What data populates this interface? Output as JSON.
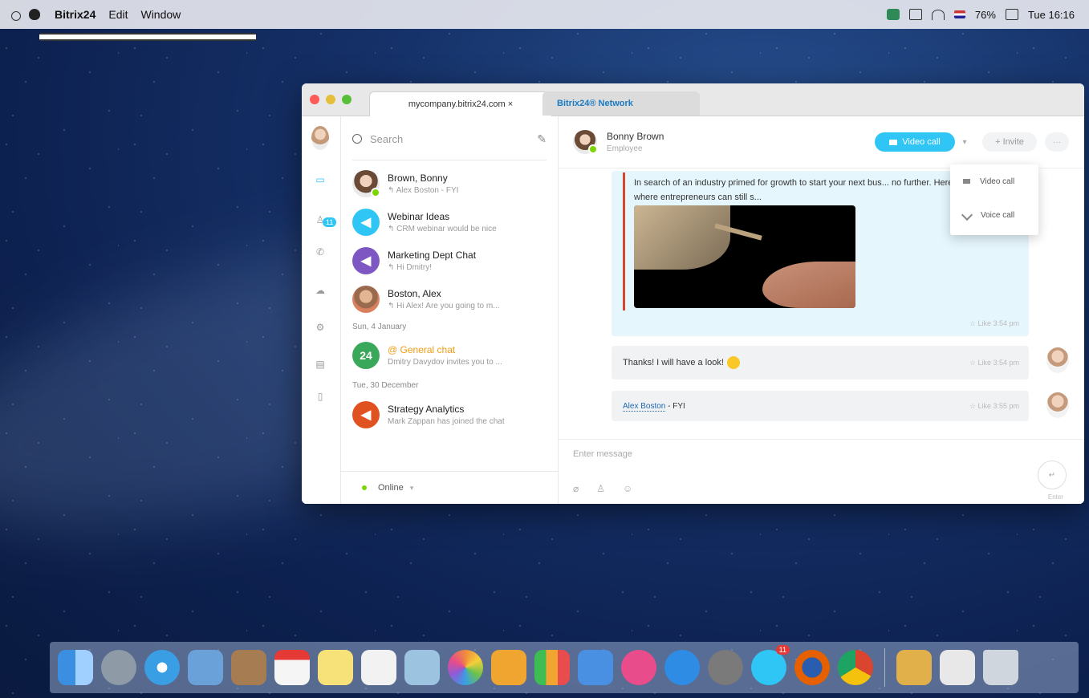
{
  "menubar": {
    "app_name": "Bitrix24",
    "menus": [
      "Edit",
      "Window"
    ],
    "battery": "76%",
    "clock": "Tue 16:16"
  },
  "window": {
    "tabs": [
      {
        "label": "mycompany.bitrix24.com ×"
      },
      {
        "label": "Bitrix24® Network"
      }
    ]
  },
  "sidebar": {
    "badge": "11",
    "icons": [
      "chat-icon",
      "contacts-icon",
      "phone-icon",
      "cloud-icon",
      "settings-icon",
      "calendar-icon",
      "document-icon"
    ]
  },
  "chat_list": {
    "search_placeholder": "Search",
    "items": [
      {
        "name": "Brown, Bonny",
        "preview": "↰ Alex Boston - FYI",
        "avatar_color": "#c49a7a"
      },
      {
        "name": "Webinar Ideas",
        "preview": "↰ CRM webinar would be nice",
        "avatar_color": "#2fc6f6"
      },
      {
        "name": "Marketing Dept Chat",
        "preview": "↰ Hi Dmitry!",
        "avatar_color": "#7e57c2"
      },
      {
        "name": "Boston, Alex",
        "preview": "↰ Hi Alex! Are you going to m...",
        "avatar_color": "#d9805f"
      },
      {
        "name": "@ General chat",
        "preview": "Dmitry Davydov invites you to ...",
        "avatar_color": "#3aa85a",
        "avatar_text": "24"
      },
      {
        "name": "Strategy Analytics",
        "preview": "Mark Zappan has joined the chat",
        "avatar_color": "#e0521f"
      }
    ],
    "date_separators": [
      "Sun, 4 January",
      "Tue, 30 December"
    ],
    "status": "Online"
  },
  "chat": {
    "contact_name": "Bonny Brown",
    "contact_role": "Employee",
    "video_call_label": "Video call",
    "invite_label": "+ Invite",
    "more_label": "···",
    "dropdown": {
      "video": "Video call",
      "voice": "Voice call"
    },
    "message1": {
      "text": "In search of an industry primed for growth to start your next bus... no further. Here are eight sectors where entrepreneurs can still s...",
      "meta": "☆ Like  3:54 pm"
    },
    "message2": {
      "text": "Thanks! I will have a look!",
      "meta": "☆ Like  3:54 pm"
    },
    "message3": {
      "mention": "Alex Boston",
      "text": " - FYI",
      "meta": "☆ Like  3:55 pm"
    },
    "composer_placeholder": "Enter message",
    "send_label": "Enter"
  },
  "dock": {
    "badge": "11",
    "apps": [
      {
        "name": "finder",
        "color": "#3b8fe0"
      },
      {
        "name": "launchpad",
        "color": "#8e9aa6"
      },
      {
        "name": "safari",
        "color": "#3a9ee4"
      },
      {
        "name": "preview",
        "color": "#6aa1d8"
      },
      {
        "name": "contacts",
        "color": "#a67c52"
      },
      {
        "name": "calendar",
        "color": "#f5f5f5"
      },
      {
        "name": "notes",
        "color": "#f7e27a"
      },
      {
        "name": "reminders",
        "color": "#f2f2f2"
      },
      {
        "name": "photo-browser",
        "color": "#9cc3e0"
      },
      {
        "name": "photos",
        "color": "#f08a3c"
      },
      {
        "name": "pages",
        "color": "#f0a530"
      },
      {
        "name": "numbers",
        "color": "#3dbd52"
      },
      {
        "name": "keynote",
        "color": "#4a90e2"
      },
      {
        "name": "itunes",
        "color": "#e94c8a"
      },
      {
        "name": "app-store",
        "color": "#2e8ce4"
      },
      {
        "name": "system-preferences",
        "color": "#7a7a7a"
      },
      {
        "name": "bitrix24",
        "color": "#2fc6f6"
      },
      {
        "name": "firefox",
        "color": "#e66000"
      },
      {
        "name": "chrome",
        "color": "#d9452f"
      },
      {
        "name": "installer",
        "color": "#e2b04a"
      },
      {
        "name": "chrome-document",
        "color": "#e8e8e8"
      },
      {
        "name": "trash",
        "color": "#cfd6dd"
      }
    ]
  }
}
